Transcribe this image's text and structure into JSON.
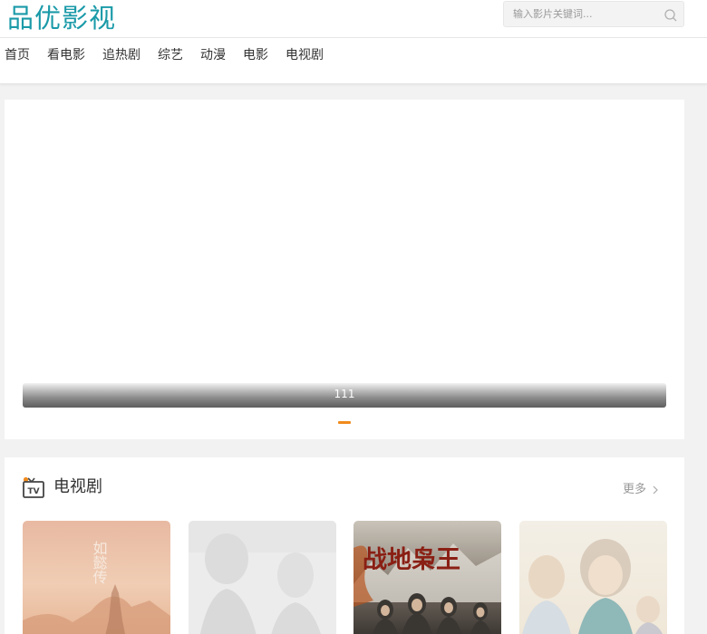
{
  "site": {
    "logo_text": "品优影视"
  },
  "search": {
    "placeholder": "输入影片关键词..."
  },
  "nav": {
    "items": [
      "首页",
      "看电影",
      "追热剧",
      "综艺",
      "动漫",
      "电影",
      "电视剧"
    ]
  },
  "banner": {
    "caption": "111",
    "pager_color": "#f08a1d"
  },
  "section": {
    "title": "电视剧",
    "more_label": "更多",
    "icon": "tv-icon",
    "posters": [
      {
        "name": "poster-1",
        "overlay_text": "如懿传"
      },
      {
        "name": "poster-2"
      },
      {
        "name": "poster-3",
        "overlay_text": "战地枭王"
      },
      {
        "name": "poster-4"
      }
    ]
  },
  "colors": {
    "brand": "#1a9aa8",
    "accent": "#f08a1d",
    "page_bg": "#f2f2f2"
  }
}
